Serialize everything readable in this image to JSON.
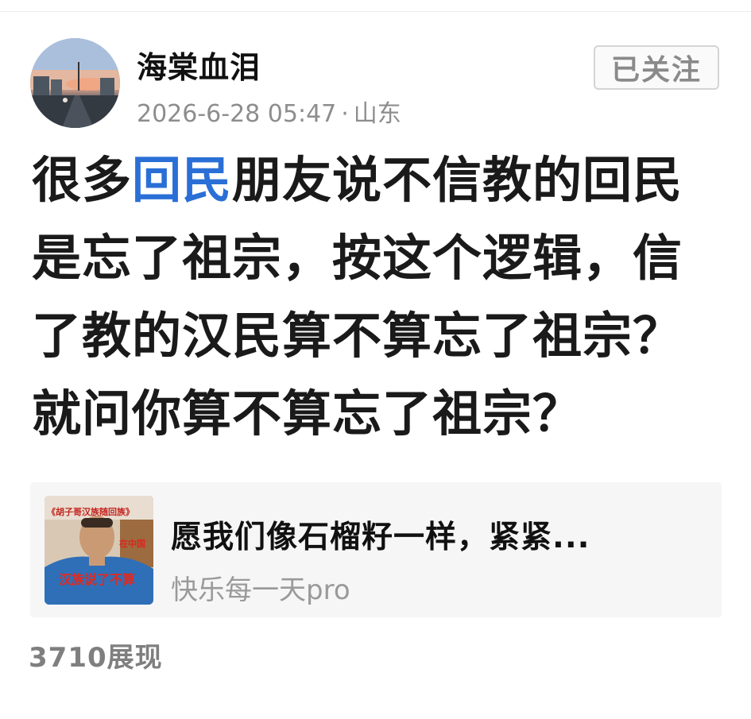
{
  "post": {
    "username": "海棠血泪",
    "timestamp": "2026-6-28 05:47",
    "separator": "·",
    "location": "山东",
    "follow_label": "已关注",
    "body": {
      "line1_before": "很多",
      "line1_tag": "回民",
      "line1_after": "朋友说不信教的回民",
      "line2": "是忘了祖宗，按这个逻辑，信",
      "line3": "了教的汉民算不算忘了祖宗？",
      "line4": "就问你算不算忘了祖宗？"
    },
    "impressions": "3710展现"
  },
  "shared_card": {
    "title": "愿我们像石榴籽一样，紧紧...",
    "author": "快乐每一天pro",
    "thumbnail_caption_top": "《胡子哥汉族随回族》",
    "thumbnail_caption_side": "在中国",
    "thumbnail_caption_bottom": "汉族说了不算"
  },
  "colors": {
    "tag_blue": "#2a6fd6",
    "text_dark": "#1a1a1a",
    "meta_gray": "#8d8d8d",
    "card_bg": "#f6f6f7"
  }
}
